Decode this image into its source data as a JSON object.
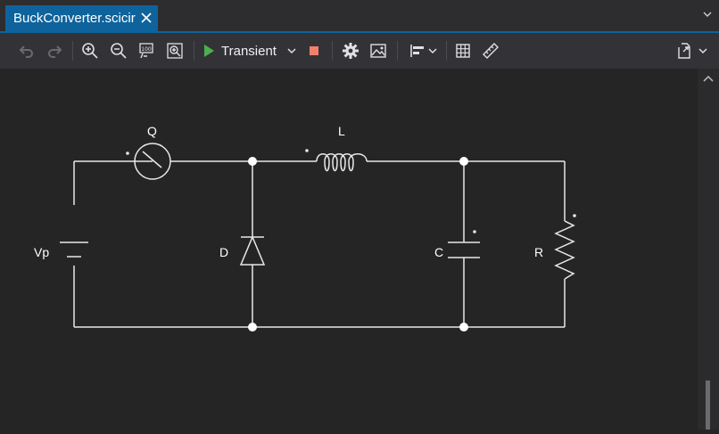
{
  "tab": {
    "title": "BuckConverter.scicir"
  },
  "toolbar": {
    "icons": [
      "undo-icon",
      "redo-icon",
      "zoom-in-icon",
      "zoom-out-icon",
      "zoom-100-icon",
      "zoom-fit-icon",
      "play-icon",
      "dropdown-icon",
      "stop-icon",
      "gear-icon",
      "image-icon",
      "align-icon",
      "grid-icon",
      "ruler-icon",
      "export-icon"
    ],
    "run_mode_label": "Transient"
  },
  "circuit": {
    "components": {
      "switch_label": "Q",
      "inductor_label": "L",
      "source_label": "Vp",
      "diode_label": "D",
      "capacitor_label": "C",
      "resistor_label": "R"
    }
  },
  "colors": {
    "accent": "#0e639c",
    "play": "#4cb04c",
    "stop": "#f0806c",
    "wire": "#e8e8e8",
    "canvas": "#252526"
  }
}
